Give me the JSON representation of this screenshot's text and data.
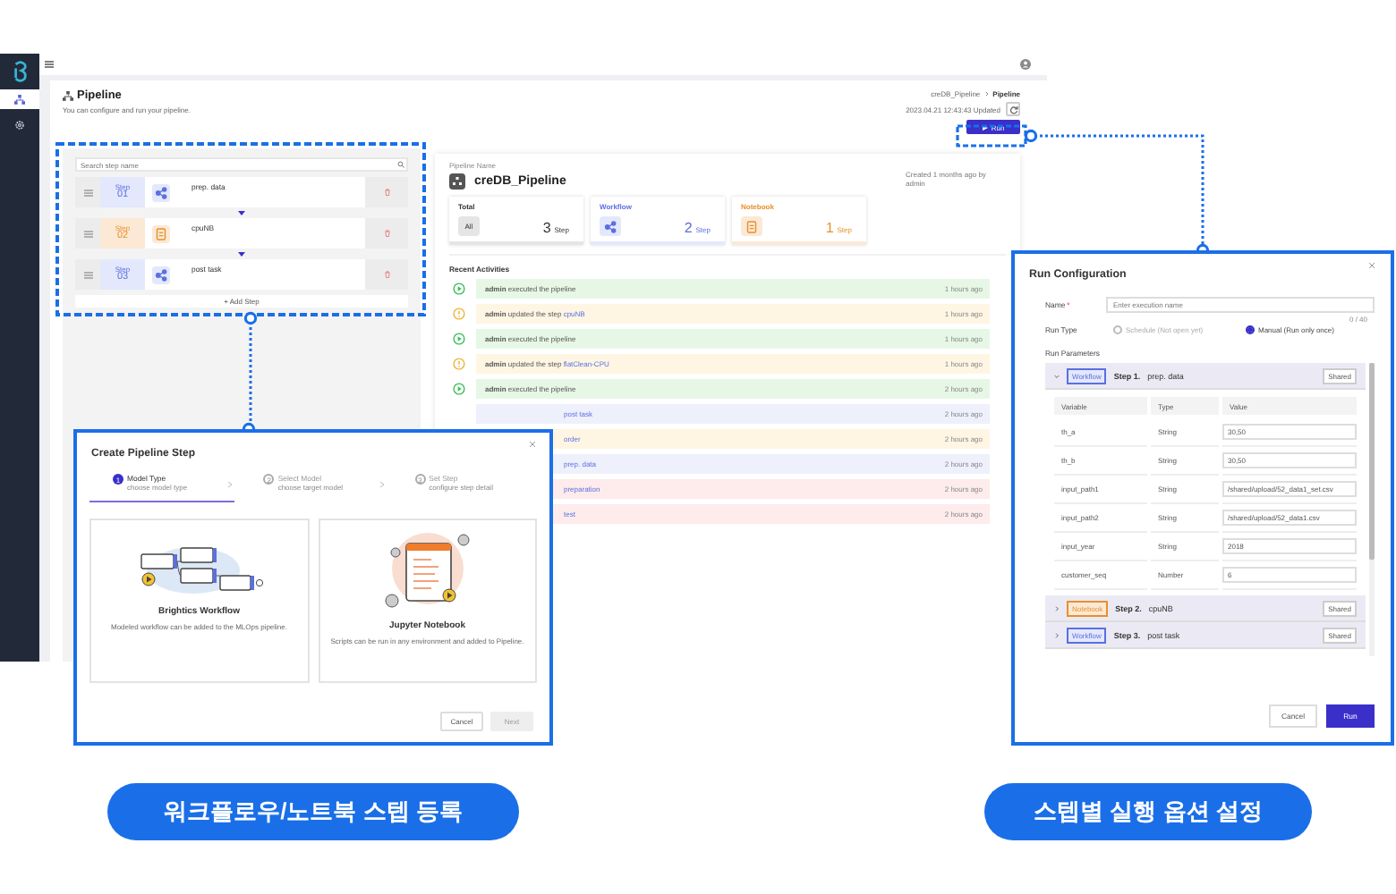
{
  "sidebar": {
    "items": [
      {
        "kind": "pipeline",
        "selected": true
      },
      {
        "kind": "settings",
        "selected": false
      }
    ]
  },
  "page": {
    "title": "Pipeline",
    "subtitle": "You can configure and run your pipeline.",
    "breadcrumb": [
      {
        "label": "creDB_Pipeline",
        "selected": false
      },
      {
        "label": "Pipeline",
        "selected": true
      }
    ],
    "updated": "2023.04.21 12:43:43 Updated",
    "run_button": "Run"
  },
  "steps": {
    "search_placeholder": "Search step name",
    "items": [
      {
        "kind": "workflow",
        "label": "Step",
        "number": "01",
        "name": "prep. data"
      },
      {
        "kind": "notebook",
        "label": "Step",
        "number": "02",
        "name": "cpuNB"
      },
      {
        "kind": "workflow",
        "label": "Step",
        "number": "03",
        "name": "post task"
      }
    ],
    "add_button": "+ Add Step"
  },
  "pipeline": {
    "name_label": "Pipeline Name",
    "name": "creDB_Pipeline",
    "created": "Created 1 months ago by",
    "created_by": "admin",
    "stats": [
      {
        "kind": "total",
        "title": "Total",
        "badge": "All",
        "count": "3",
        "unit": "Step"
      },
      {
        "kind": "workflow",
        "title": "Workflow",
        "count": "2",
        "unit": "Step"
      },
      {
        "kind": "notebook",
        "title": "Notebook",
        "count": "1",
        "unit": "Step"
      }
    ]
  },
  "recent_activities": {
    "title": "Recent Activities",
    "items": [
      {
        "kind": "executed",
        "text": "**admin** executed the pipeline",
        "time": "1 hours ago"
      },
      {
        "kind": "updated",
        "text": "**admin** updated the step",
        "link": "cpuNB",
        "time": "1 hours ago"
      },
      {
        "kind": "executed",
        "text": "**admin** executed the pipeline",
        "time": "1 hours ago"
      },
      {
        "kind": "updated",
        "text": "**admin** updated the step",
        "link": "flatClean-CPU",
        "time": "1 hours ago"
      },
      {
        "kind": "executed",
        "text": "**admin** executed the pipeline",
        "time": "2 hours ago"
      },
      {
        "kind": "added",
        "link": "post task",
        "time": "2 hours ago"
      },
      {
        "kind": "updated",
        "link": "order",
        "time": "2 hours ago"
      },
      {
        "kind": "added",
        "link": "prep. data",
        "time": "2 hours ago"
      },
      {
        "kind": "deleted",
        "link": "preparation",
        "time": "2 hours ago"
      },
      {
        "kind": "deleted",
        "link": "test",
        "time": "2 hours ago"
      }
    ]
  },
  "create_step_dialog": {
    "title": "Create Pipeline Step",
    "wizard": [
      {
        "number": "1",
        "title": "Model Type",
        "subtitle": "choose model type",
        "selected": true
      },
      {
        "number": "2",
        "title": "Select Model",
        "subtitle": "choose target model",
        "selected": false
      },
      {
        "number": "3",
        "title": "Set Step",
        "subtitle": "configure step detail",
        "selected": false
      }
    ],
    "options": [
      {
        "kind": "workflow",
        "title": "Brightics Workflow",
        "description": "Modeled workflow can be added to the MLOps pipeline."
      },
      {
        "kind": "notebook",
        "title": "Jupyter Notebook",
        "description": "Scripts can be run in any environment and added to Pipeline."
      }
    ],
    "buttons": [
      {
        "label": "Cancel",
        "disabled": false
      },
      {
        "label": "Next",
        "disabled": true
      }
    ]
  },
  "run_configuration": {
    "title": "Run Configuration",
    "name_label": "Name",
    "required_mark": "*",
    "name_placeholder": "Enter execution name",
    "counter": "0 / 40",
    "run_type_label": "Run Type",
    "run_types": [
      {
        "label": "Schedule (Not open yet)",
        "selected": false,
        "disabled": true
      },
      {
        "label": "Manual (Run only once)",
        "selected": true,
        "disabled": false
      }
    ],
    "parameters_label": "Run Parameters",
    "steps": [
      {
        "kind": "workflow",
        "tag": "Workflow",
        "title": "Step 1.",
        "name": "prep. data",
        "shared": "Shared",
        "expanded": true,
        "columns": [
          "Variable",
          "Type",
          "Value"
        ],
        "variables": [
          {
            "variable": "th_a",
            "type": "String",
            "value": "30,50"
          },
          {
            "variable": "th_b",
            "type": "String",
            "value": "30,50"
          },
          {
            "variable": "input_path1",
            "type": "String",
            "value": "/shared/upload/52_data1_set.csv"
          },
          {
            "variable": "input_path2",
            "type": "String",
            "value": "/shared/upload/52_data1.csv"
          },
          {
            "variable": "input_year",
            "type": "String",
            "value": "2018"
          },
          {
            "variable": "customer_seq",
            "type": "Number",
            "value": "6"
          }
        ]
      },
      {
        "kind": "notebook",
        "tag": "Notebook",
        "title": "Step 2.",
        "name": "cpuNB",
        "shared": "Shared",
        "expanded": false
      },
      {
        "kind": "workflow",
        "tag": "Workflow",
        "title": "Step 3.",
        "name": "post task",
        "shared": "Shared",
        "expanded": false
      }
    ],
    "buttons": [
      {
        "label": "Cancel",
        "kind": "secondary"
      },
      {
        "label": "Run",
        "kind": "primary"
      }
    ]
  },
  "callouts": [
    "워크플로우/노트북 스텝 등록",
    "스텝별 실행 옵션 설정"
  ]
}
